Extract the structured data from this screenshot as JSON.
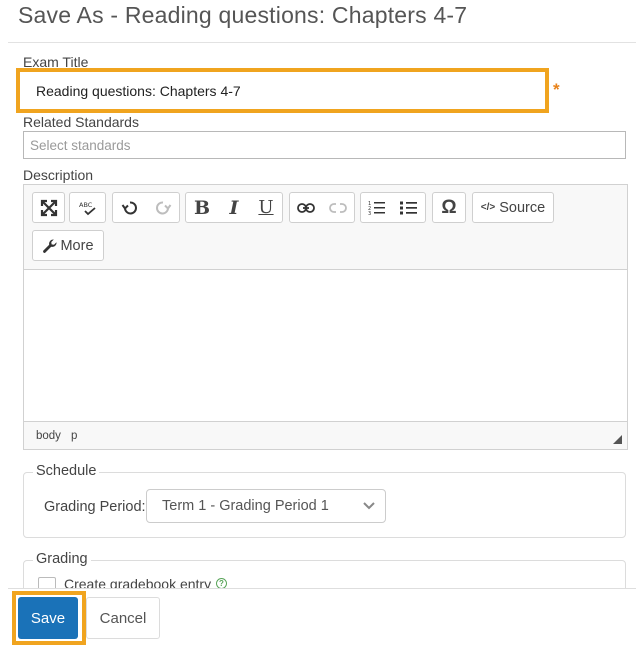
{
  "dialog": {
    "title": "Save As - Reading questions: Chapters 4-7"
  },
  "exam_title": {
    "label": "Exam Title",
    "value": "Reading questions: Chapters 4-7",
    "required_marker": "*"
  },
  "standards": {
    "label": "Related Standards",
    "placeholder": "Select standards"
  },
  "description": {
    "label": "Description",
    "toolbar": {
      "source_label": "Source",
      "more_label": "More"
    },
    "status_path": [
      "body",
      "p"
    ]
  },
  "schedule": {
    "legend": "Schedule",
    "grading_period_label": "Grading Period:",
    "grading_period_value": "Term 1 - Grading Period 1"
  },
  "grading": {
    "legend": "Grading",
    "gradebook_label": "Create gradebook entry"
  },
  "footer": {
    "save_label": "Save",
    "cancel_label": "Cancel"
  },
  "colors": {
    "highlight": "#f0a41f",
    "primary": "#1a72b8",
    "required": "#e8821a"
  },
  "icons": [
    "maximize-icon",
    "spellcheck-icon",
    "undo-icon",
    "redo-icon",
    "bold-icon",
    "italic-icon",
    "underline-icon",
    "link-icon",
    "unlink-icon",
    "numbered-list-icon",
    "bulleted-list-icon",
    "omega-icon",
    "source-code-icon",
    "wrench-icon",
    "chevron-down-icon",
    "help-icon"
  ]
}
